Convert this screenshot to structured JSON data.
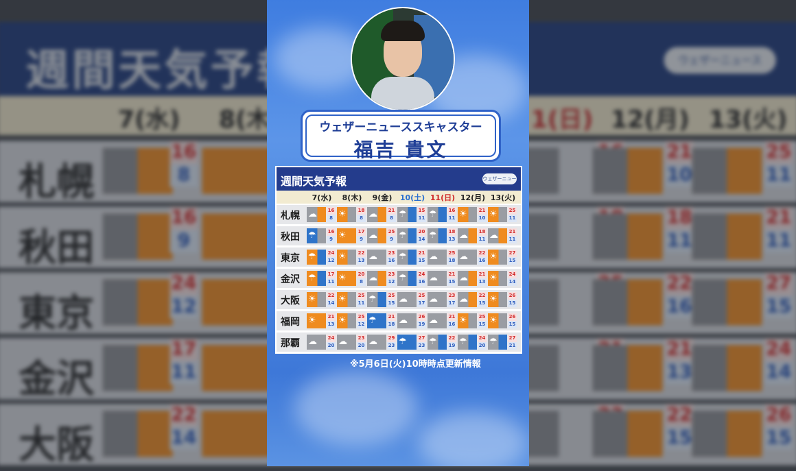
{
  "background": {
    "title": "週間天気予報",
    "logo": "ウェザーニュース",
    "dates": [
      "7(水)",
      "8(木",
      "1(日)",
      "12(月)",
      "13(火)"
    ],
    "cities": [
      "札幌",
      "秋田",
      "東京",
      "金沢",
      "大阪"
    ],
    "left_temps": [
      [
        "16",
        "8"
      ],
      [
        "16",
        "9"
      ],
      [
        "24",
        "12"
      ],
      [
        "17",
        "11"
      ],
      [
        "22",
        "14"
      ]
    ],
    "right_temps": [
      [
        [
          "16",
          "11"
        ],
        [
          "21",
          "10"
        ],
        [
          "25",
          "11"
        ]
      ],
      [
        [
          "18",
          "13"
        ],
        [
          "18",
          "11"
        ],
        [
          "21",
          "11"
        ]
      ],
      [
        [
          "25",
          "18"
        ],
        [
          "22",
          "16"
        ],
        [
          "27",
          "15"
        ]
      ],
      [
        [
          "21",
          "15"
        ],
        [
          "21",
          "13"
        ],
        [
          "24",
          "14"
        ]
      ],
      [
        [
          "23",
          "17"
        ],
        [
          "22",
          "15"
        ],
        [
          "26",
          "15"
        ]
      ]
    ]
  },
  "caster": {
    "title": "ウェザーニューススキャスター",
    "name": "福吉 貴文"
  },
  "forecast": {
    "title": "週間天気予報",
    "logo": "ウェザーニュース",
    "dates": [
      "7(水)",
      "8(木)",
      "9(金)",
      "10(土)",
      "11(日)",
      "12(月)",
      "13(火)"
    ],
    "date_colors": [
      "#222222",
      "#222222",
      "#222222",
      "#2a6fd0",
      "#d02b2b",
      "#222222",
      "#222222"
    ],
    "rows": [
      {
        "city": "札幌",
        "days": [
          {
            "wx": "cs",
            "hi": "16",
            "lo": "8"
          },
          {
            "wx": "sc",
            "hi": "18",
            "lo": "8"
          },
          {
            "wx": "cs",
            "hi": "21",
            "lo": "8"
          },
          {
            "wx": "cr",
            "hi": "15",
            "lo": "11"
          },
          {
            "wx": "cr",
            "hi": "16",
            "lo": "11"
          },
          {
            "wx": "sc",
            "hi": "21",
            "lo": "10"
          },
          {
            "wx": "sc",
            "hi": "25",
            "lo": "11"
          }
        ]
      },
      {
        "city": "秋田",
        "days": [
          {
            "wx": "rc",
            "hi": "16",
            "lo": "9"
          },
          {
            "wx": "sunny",
            "hi": "17",
            "lo": "9"
          },
          {
            "wx": "cs",
            "hi": "25",
            "lo": "9"
          },
          {
            "wx": "cr",
            "hi": "20",
            "lo": "14"
          },
          {
            "wx": "cr",
            "hi": "18",
            "lo": "13"
          },
          {
            "wx": "cs",
            "hi": "18",
            "lo": "11"
          },
          {
            "wx": "cs",
            "hi": "21",
            "lo": "11"
          }
        ]
      },
      {
        "city": "東京",
        "days": [
          {
            "wx": "sr",
            "hi": "24",
            "lo": "12"
          },
          {
            "wx": "sc",
            "hi": "22",
            "lo": "13"
          },
          {
            "wx": "cloudy",
            "hi": "23",
            "lo": "16"
          },
          {
            "wx": "cr",
            "hi": "21",
            "lo": "15"
          },
          {
            "wx": "cloudy",
            "hi": "25",
            "lo": "18"
          },
          {
            "wx": "cloudy",
            "hi": "22",
            "lo": "16"
          },
          {
            "wx": "sc",
            "hi": "27",
            "lo": "15"
          }
        ]
      },
      {
        "city": "金沢",
        "days": [
          {
            "wx": "sr",
            "hi": "17",
            "lo": "11"
          },
          {
            "wx": "sunny",
            "hi": "20",
            "lo": "8"
          },
          {
            "wx": "cs",
            "hi": "23",
            "lo": "12"
          },
          {
            "wx": "cr",
            "hi": "24",
            "lo": "16"
          },
          {
            "wx": "cloudy",
            "hi": "21",
            "lo": "15"
          },
          {
            "wx": "cs",
            "hi": "21",
            "lo": "13"
          },
          {
            "wx": "sc",
            "hi": "24",
            "lo": "14"
          }
        ]
      },
      {
        "city": "大阪",
        "days": [
          {
            "wx": "sc",
            "hi": "22",
            "lo": "14"
          },
          {
            "wx": "sc",
            "hi": "25",
            "lo": "11"
          },
          {
            "wx": "cr",
            "hi": "25",
            "lo": "15"
          },
          {
            "wx": "cloudy",
            "hi": "25",
            "lo": "17"
          },
          {
            "wx": "cloudy",
            "hi": "23",
            "lo": "17"
          },
          {
            "wx": "cs",
            "hi": "22",
            "lo": "15"
          },
          {
            "wx": "sc",
            "hi": "26",
            "lo": "15"
          }
        ]
      },
      {
        "city": "福岡",
        "days": [
          {
            "wx": "sunny",
            "hi": "21",
            "lo": "13"
          },
          {
            "wx": "sc",
            "hi": "25",
            "lo": "12"
          },
          {
            "wx": "rain",
            "hi": "21",
            "lo": "18"
          },
          {
            "wx": "cloudy",
            "hi": "26",
            "lo": "19"
          },
          {
            "wx": "cloudy",
            "hi": "21",
            "lo": "16"
          },
          {
            "wx": "sc",
            "hi": "25",
            "lo": "15"
          },
          {
            "wx": "sc",
            "hi": "26",
            "lo": "15"
          }
        ]
      },
      {
        "city": "那覇",
        "days": [
          {
            "wx": "cloudy",
            "hi": "24",
            "lo": "20"
          },
          {
            "wx": "cloudy",
            "hi": "23",
            "lo": "20"
          },
          {
            "wx": "cloudy",
            "hi": "29",
            "lo": "23"
          },
          {
            "wx": "rain",
            "hi": "27",
            "lo": "23"
          },
          {
            "wx": "cr",
            "hi": "22",
            "lo": "19"
          },
          {
            "wx": "cr",
            "hi": "24",
            "lo": "20"
          },
          {
            "wx": "cr",
            "hi": "27",
            "lo": "21"
          }
        ]
      }
    ]
  },
  "footnote": "※5月6日(火)10時時点更新情報"
}
